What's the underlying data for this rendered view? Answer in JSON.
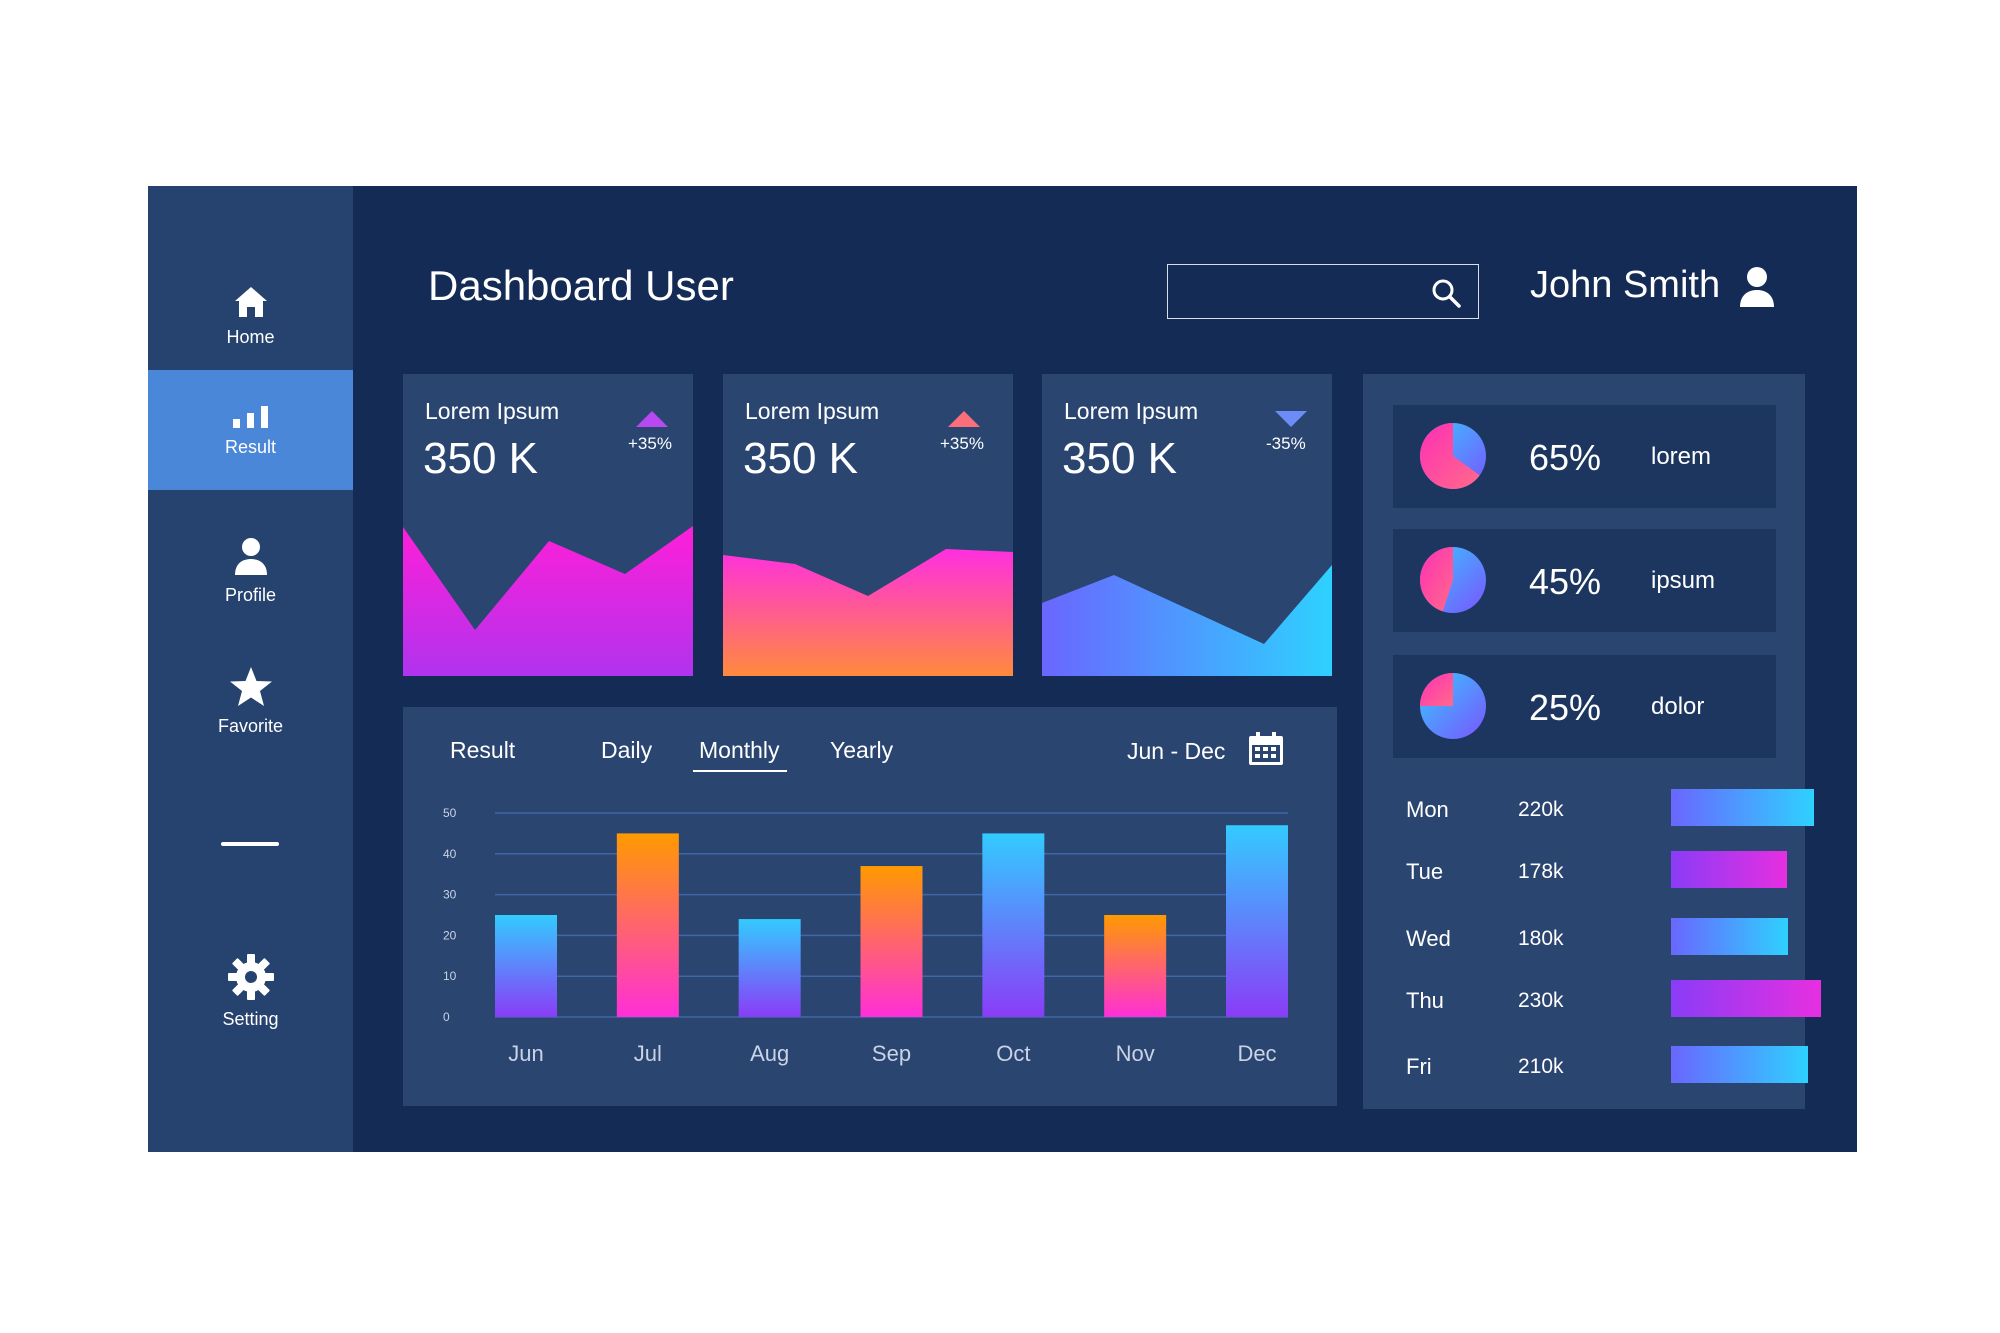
{
  "sidebar": {
    "items": [
      {
        "label": "Home",
        "icon": "home-icon",
        "active": false
      },
      {
        "label": "Result",
        "icon": "bar-chart-icon",
        "active": true
      },
      {
        "label": "Profile",
        "icon": "user-icon",
        "active": false
      },
      {
        "label": "Favorite",
        "icon": "star-icon",
        "active": false
      },
      {
        "label": "Setting",
        "icon": "gear-icon",
        "active": false
      }
    ]
  },
  "header": {
    "title": "Dashboard User",
    "search_placeholder": "",
    "user_name": "John Smith"
  },
  "cards": [
    {
      "title": "Lorem Ipsum",
      "value": "350 K",
      "change": "+35%",
      "direction": "up",
      "arrow_color": "#a855f7"
    },
    {
      "title": "Lorem Ipsum",
      "value": "350 K",
      "change": "+35%",
      "direction": "up",
      "arrow_color": "#fb7185"
    },
    {
      "title": "Lorem Ipsum",
      "value": "350 K",
      "change": "-35%",
      "direction": "down",
      "arrow_color": "#6d8cf7"
    }
  ],
  "result_panel": {
    "label": "Result",
    "tabs": [
      "Daily",
      "Monthly",
      "Yearly"
    ],
    "active_tab": "Monthly",
    "date_range": "Jun - Dec"
  },
  "chart_data": {
    "type": "bar",
    "categories": [
      "Jun",
      "Jul",
      "Aug",
      "Sep",
      "Oct",
      "Nov",
      "Dec"
    ],
    "values": [
      25,
      45,
      24,
      37,
      45,
      25,
      47
    ],
    "ylim": [
      0,
      50
    ],
    "yticks": [
      "0",
      "10",
      "20",
      "30",
      "40",
      "50"
    ],
    "grid": true,
    "title": "",
    "xlabel": "",
    "ylabel": ""
  },
  "stats": [
    {
      "percent": "65%",
      "label": "lorem",
      "value": 0.65
    },
    {
      "percent": "45%",
      "label": "ipsum",
      "value": 0.45
    },
    {
      "percent": "25%",
      "label": "dolor",
      "value": 0.25
    }
  ],
  "daily": [
    {
      "day": "Mon",
      "value": "220k",
      "amount": 220,
      "style": "blue"
    },
    {
      "day": "Tue",
      "value": "178k",
      "amount": 178,
      "style": "purple"
    },
    {
      "day": "Wed",
      "value": "180k",
      "amount": 180,
      "style": "blue"
    },
    {
      "day": "Thu",
      "value": "230k",
      "amount": 230,
      "style": "purple"
    },
    {
      "day": "Fri",
      "value": "210k",
      "amount": 210,
      "style": "blue"
    }
  ],
  "colors": {
    "background": "#142b55",
    "sidebar": "#26426e",
    "panel": "#2a4570",
    "active_nav": "#4b87d9",
    "magenta": "#e62fe0",
    "orange": "#ff9a00",
    "cyan": "#35c8ff",
    "violet": "#8a3cf7"
  }
}
